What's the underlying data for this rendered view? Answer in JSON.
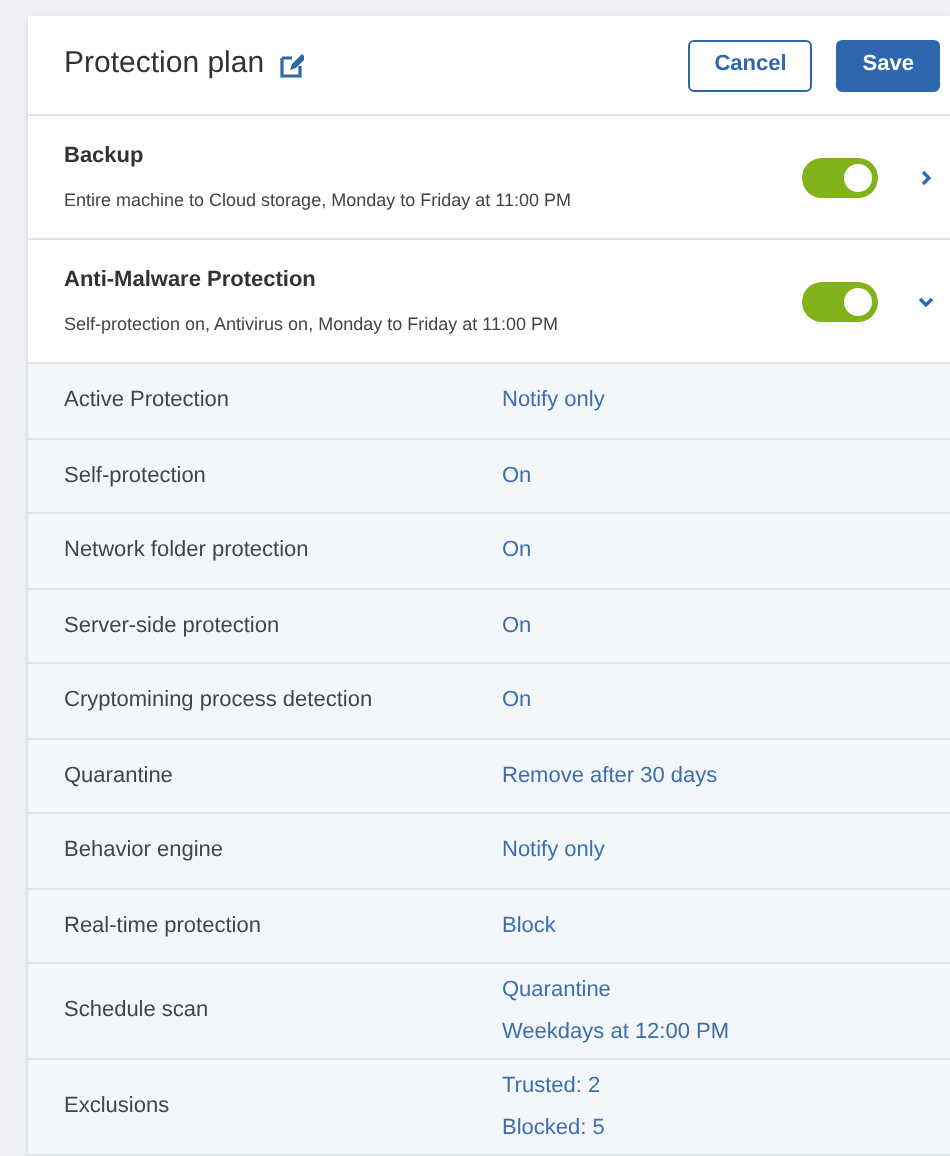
{
  "header": {
    "title": "Protection plan",
    "buttons": [
      {
        "label": "Cancel",
        "kind": "secondary"
      },
      {
        "label": "Save",
        "kind": "primary"
      }
    ]
  },
  "modules": [
    {
      "title": "Backup",
      "summary": "Entire machine to Cloud storage, Monday to Friday at 11:00 PM",
      "on": true,
      "expanded": false
    },
    {
      "title": "Anti-Malware Protection",
      "summary": "Self-protection on, Antivirus on, Monday to Friday at 11:00 PM",
      "on": true,
      "expanded": true
    }
  ],
  "settings": [
    {
      "name": "Active Protection",
      "values": [
        "Notify only"
      ]
    },
    {
      "name": "Self-protection",
      "values": [
        "On"
      ]
    },
    {
      "name": "Network folder protection",
      "values": [
        "On"
      ]
    },
    {
      "name": "Server-side protection",
      "values": [
        "On"
      ]
    },
    {
      "name": "Cryptomining process detection",
      "values": [
        "On"
      ]
    },
    {
      "name": "Quarantine",
      "values": [
        "Remove after 30 days"
      ]
    },
    {
      "name": "Behavior engine",
      "values": [
        "Notify only"
      ]
    },
    {
      "name": "Real-time protection",
      "values": [
        "Block"
      ]
    },
    {
      "name": "Schedule scan",
      "values": [
        "Quarantine",
        "Weekdays at 12:00 PM"
      ]
    },
    {
      "name": "Exclusions",
      "values": [
        "Trusted: 2",
        "Blocked: 5"
      ]
    }
  ]
}
